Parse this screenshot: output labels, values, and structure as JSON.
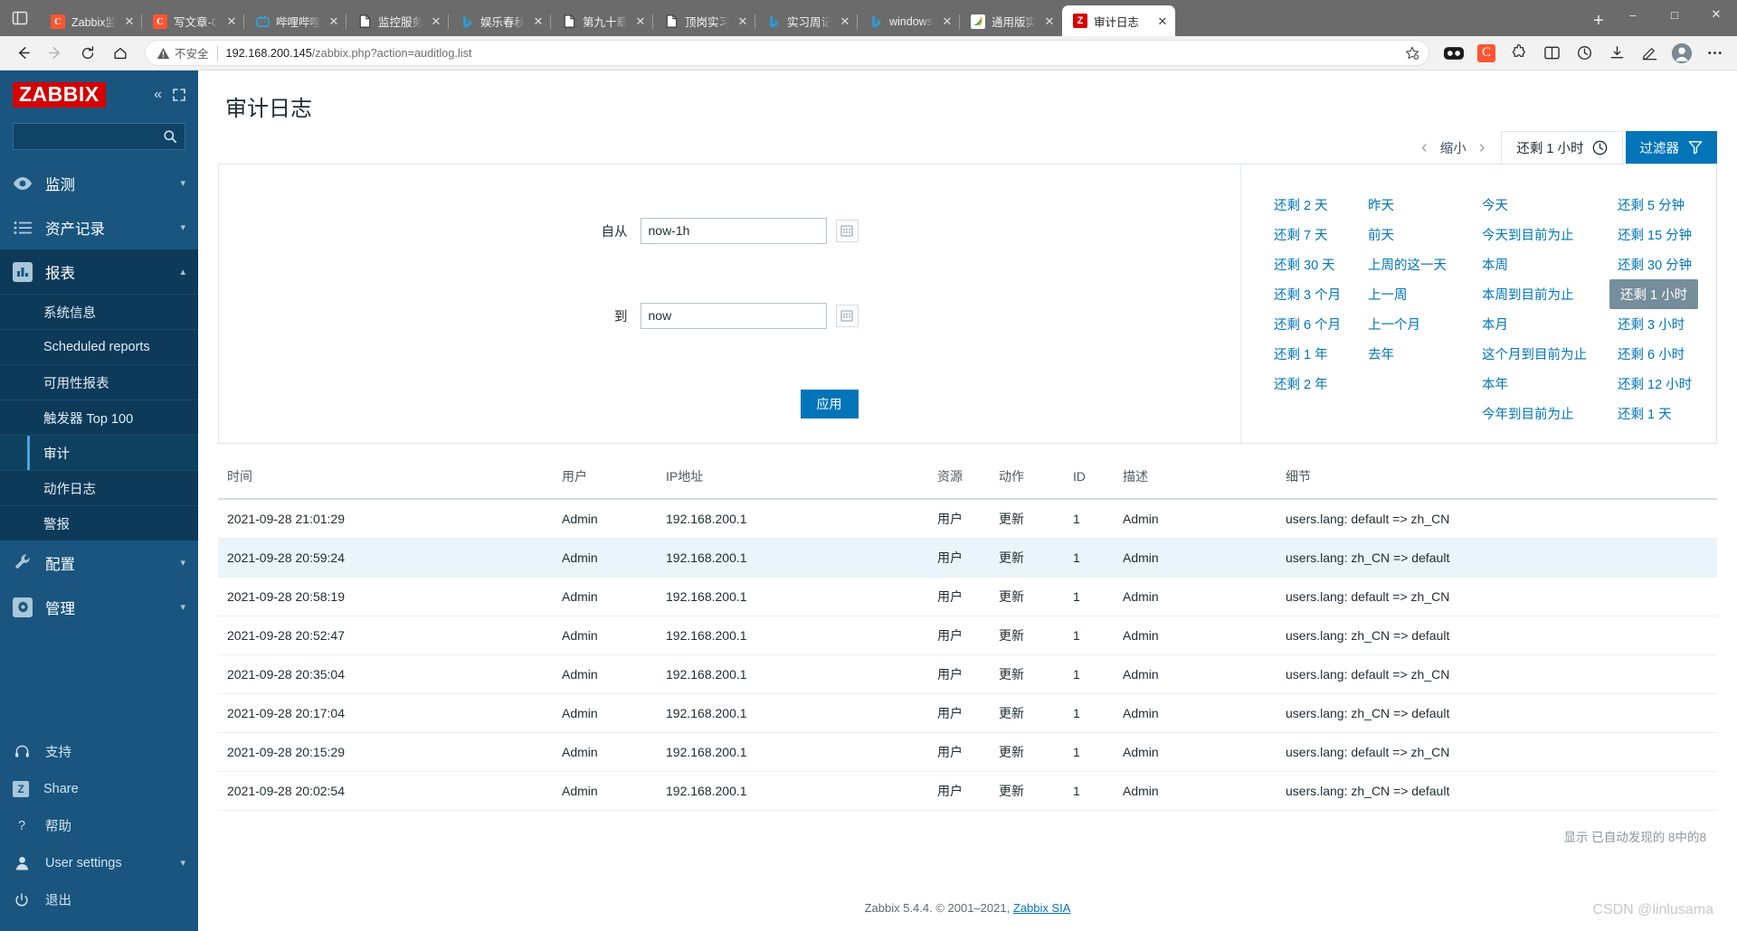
{
  "browser": {
    "sidebar_toggle_icon": "panel-icon",
    "tabs": [
      {
        "title": "Zabbix监",
        "favicon": "csdn-icon",
        "active": false
      },
      {
        "title": "写文章-C",
        "favicon": "csdn-icon",
        "active": false
      },
      {
        "title": "哔哩哔哩",
        "favicon": "bilibili-icon",
        "active": false
      },
      {
        "title": "监控服务",
        "favicon": "document-icon",
        "active": false
      },
      {
        "title": "娱乐春秋",
        "favicon": "bing-icon",
        "active": false
      },
      {
        "title": "第九十章",
        "favicon": "document-icon",
        "active": false
      },
      {
        "title": "顶岗实习",
        "favicon": "document-icon",
        "active": false
      },
      {
        "title": "实习周记",
        "favicon": "bing-icon",
        "active": false
      },
      {
        "title": "windows",
        "favicon": "bing-icon",
        "active": false
      },
      {
        "title": "通用版实",
        "favicon": "green-icon",
        "active": false
      },
      {
        "title": "审计日志",
        "favicon": "zabbix-icon",
        "active": true
      }
    ],
    "new_tab_label": "+",
    "window_controls": {
      "minimize": "–",
      "maximize": "□",
      "close": "✕"
    },
    "toolbar": {
      "back_icon": "back-arrow-icon",
      "forward_icon": "forward-arrow-icon",
      "reload_icon": "reload-icon",
      "home_icon": "home-icon",
      "security_label": "不安全",
      "url_host": "192.168.200.145",
      "url_path": "/zabbix.php?action=auditlog.list",
      "star_icon": "add-favorite-icon",
      "extensions": [
        "collections-icon",
        "csdn-extension-icon",
        "puzzle-icon",
        "split-screen-icon",
        "history-icon",
        "downloads-icon",
        "editor-icon",
        "profile-icon",
        "more-icon"
      ]
    }
  },
  "sidebar": {
    "logo": "ZABBIX",
    "collapse_icon": "chevron-double-left-icon",
    "expand_icon": "expand-icon",
    "search_placeholder": "",
    "search_value": "",
    "search_icon": "search-icon",
    "nav": [
      {
        "label": "监测",
        "icon": "eye-icon",
        "expanded": false
      },
      {
        "label": "资产记录",
        "icon": "list-icon",
        "expanded": false
      },
      {
        "label": "报表",
        "icon": "chart-bar-icon",
        "expanded": true,
        "children": [
          {
            "label": "系统信息",
            "selected": false
          },
          {
            "label": "Scheduled reports",
            "selected": false
          },
          {
            "label": "可用性报表",
            "selected": false
          },
          {
            "label": "触发器 Top 100",
            "selected": false
          },
          {
            "label": "审计",
            "selected": true
          },
          {
            "label": "动作日志",
            "selected": false
          },
          {
            "label": "警报",
            "selected": false
          }
        ]
      },
      {
        "label": "配置",
        "icon": "wrench-icon",
        "expanded": false
      },
      {
        "label": "管理",
        "icon": "gear-icon",
        "expanded": false
      }
    ],
    "footer": [
      {
        "label": "支持",
        "icon": "headset-icon",
        "caret": false
      },
      {
        "label": "Share",
        "icon": "zabbix-z-icon",
        "caret": false
      },
      {
        "label": "帮助",
        "icon": "question-icon",
        "caret": false
      },
      {
        "label": "User settings",
        "icon": "user-icon",
        "caret": true
      },
      {
        "label": "退出",
        "icon": "power-icon",
        "caret": false
      }
    ]
  },
  "page": {
    "title": "审计日志"
  },
  "timebar": {
    "prev_icon": "chevron-left-icon",
    "zoom_out_label": "缩小",
    "next_icon": "chevron-right-icon",
    "time_tab_label": "还剩 1 小时",
    "clock_icon": "clock-icon",
    "filter_label": "过滤器",
    "filter_icon": "funnel-icon"
  },
  "timepanel": {
    "from_label": "自从",
    "from_value": "now-1h",
    "to_label": "到",
    "to_value": "now",
    "calendar_icon": "calendar-icon",
    "apply_label": "应用",
    "columns": [
      {
        "links": [
          "还剩 2 天",
          "还剩 7 天",
          "还剩 30 天",
          "还剩 3 个月",
          "还剩 6 个月",
          "还剩 1 年",
          "还剩 2 年"
        ]
      },
      {
        "links": [
          "昨天",
          "前天",
          "上周的这一天",
          "上一周",
          "上一个月",
          "去年"
        ]
      },
      {
        "links": [
          "今天",
          "今天到目前为止",
          "本周",
          "本周到目前为止",
          "本月",
          "这个月到目前为止",
          "本年",
          "今年到目前为止"
        ]
      },
      {
        "links": [
          "还剩 5 分钟",
          "还剩 15 分钟",
          "还剩 30 分钟",
          "还剩 1 小时",
          "还剩 3 小时",
          "还剩 6 小时",
          "还剩 12 小时",
          "还剩 1 天"
        ]
      }
    ],
    "selected_link": "还剩 1 小时"
  },
  "table": {
    "headers": [
      "时间",
      "用户",
      "IP地址",
      "资源",
      "动作",
      "ID",
      "描述",
      "细节"
    ],
    "rows": [
      {
        "time": "2021-09-28 21:01:29",
        "user": "Admin",
        "ip": "192.168.200.1",
        "resource": "用户",
        "action": "更新",
        "id": "1",
        "desc": "Admin",
        "details": "users.lang: default => zh_CN"
      },
      {
        "time": "2021-09-28 20:59:24",
        "user": "Admin",
        "ip": "192.168.200.1",
        "resource": "用户",
        "action": "更新",
        "id": "1",
        "desc": "Admin",
        "details": "users.lang: zh_CN => default"
      },
      {
        "time": "2021-09-28 20:58:19",
        "user": "Admin",
        "ip": "192.168.200.1",
        "resource": "用户",
        "action": "更新",
        "id": "1",
        "desc": "Admin",
        "details": "users.lang: default => zh_CN"
      },
      {
        "time": "2021-09-28 20:52:47",
        "user": "Admin",
        "ip": "192.168.200.1",
        "resource": "用户",
        "action": "更新",
        "id": "1",
        "desc": "Admin",
        "details": "users.lang: zh_CN => default"
      },
      {
        "time": "2021-09-28 20:35:04",
        "user": "Admin",
        "ip": "192.168.200.1",
        "resource": "用户",
        "action": "更新",
        "id": "1",
        "desc": "Admin",
        "details": "users.lang: default => zh_CN"
      },
      {
        "time": "2021-09-28 20:17:04",
        "user": "Admin",
        "ip": "192.168.200.1",
        "resource": "用户",
        "action": "更新",
        "id": "1",
        "desc": "Admin",
        "details": "users.lang: zh_CN => default"
      },
      {
        "time": "2021-09-28 20:15:29",
        "user": "Admin",
        "ip": "192.168.200.1",
        "resource": "用户",
        "action": "更新",
        "id": "1",
        "desc": "Admin",
        "details": "users.lang: default => zh_CN"
      },
      {
        "time": "2021-09-28 20:02:54",
        "user": "Admin",
        "ip": "192.168.200.1",
        "resource": "用户",
        "action": "更新",
        "id": "1",
        "desc": "Admin",
        "details": "users.lang: zh_CN => default"
      }
    ],
    "footer_text": "显示 已自动发现的 8中的8"
  },
  "footer": {
    "text": "Zabbix 5.4.4. © 2001–2021, ",
    "link": "Zabbix SIA",
    "watermark": "CSDN @linlusama"
  },
  "colors": {
    "zabbix_blue": "#19557f",
    "zabbix_red": "#d40000",
    "accent": "#0275b8",
    "row_alt": "#e9f4fb",
    "selected_chip": "#768d9b"
  }
}
